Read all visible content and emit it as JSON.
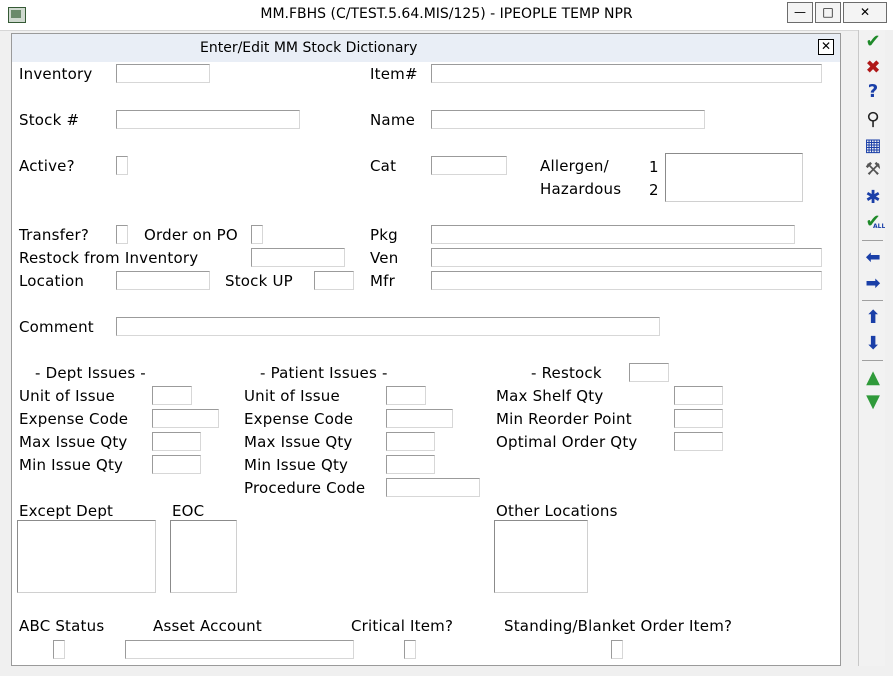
{
  "window": {
    "title": "MM.FBHS (C/TEST.5.64.MIS/125) - IPEOPLE TEMP NPR",
    "minimize_glyph": "—",
    "maximize_glyph": "□",
    "close_glyph": "✕"
  },
  "form": {
    "title": "Enter/Edit MM Stock Dictionary",
    "close_glyph": "✕",
    "labels": {
      "inventory": "Inventory",
      "item_no": "Item#",
      "stock_no": "Stock #",
      "name": "Name",
      "active": "Active?",
      "cat": "Cat",
      "allergen": "Allergen/",
      "hazardous": "Hazardous",
      "allergen_1": "1",
      "allergen_2": "2",
      "transfer": "Transfer?",
      "order_on_po": "Order on PO",
      "pkg": "Pkg",
      "restock_from_inventory": "Restock from Inventory",
      "ven": "Ven",
      "location": "Location",
      "stock_up": "Stock UP",
      "mfr": "Mfr",
      "comment": "Comment",
      "dept_issues": "- Dept Issues -",
      "patient_issues": "- Patient Issues -",
      "restock": "- Restock",
      "dept_unit_of_issue": "Unit of Issue",
      "dept_expense_code": "Expense Code",
      "dept_max_issue_qty": "Max Issue Qty",
      "dept_min_issue_qty": "Min Issue Qty",
      "pat_unit_of_issue": "Unit of Issue",
      "pat_expense_code": "Expense Code",
      "pat_max_issue_qty": "Max Issue Qty",
      "pat_min_issue_qty": "Min Issue Qty",
      "procedure_code": "Procedure Code",
      "max_shelf_qty": "Max Shelf Qty",
      "min_reorder_point": "Min Reorder Point",
      "optimal_order_qty": "Optimal Order Qty",
      "except_dept": "Except Dept",
      "eoc": "EOC",
      "other_locations": "Other Locations",
      "abc_status": "ABC Status",
      "asset_account": "Asset Account",
      "critical_item": "Critical Item?",
      "standing_blanket": "Standing/Blanket Order Item?"
    },
    "values": {
      "inventory": "",
      "item_no": "",
      "stock_no": "",
      "name": "",
      "cat": "",
      "pkg": "",
      "restock_from_inventory": "",
      "ven": "",
      "location": "",
      "stock_up": "",
      "mfr": "",
      "comment": "",
      "restock": "",
      "dept_unit_of_issue": "",
      "dept_expense_code": "",
      "dept_max_issue_qty": "",
      "dept_min_issue_qty": "",
      "pat_unit_of_issue": "",
      "pat_expense_code": "",
      "pat_max_issue_qty": "",
      "pat_min_issue_qty": "",
      "procedure_code": "",
      "max_shelf_qty": "",
      "min_reorder_point": "",
      "optimal_order_qty": "",
      "asset_account": ""
    }
  },
  "toolbar": {
    "items": [
      {
        "name": "ok-icon",
        "glyph": "✔",
        "color": "#1f8a2a"
      },
      {
        "name": "cancel-icon",
        "glyph": "✖",
        "color": "#b01818"
      },
      {
        "name": "help-icon",
        "glyph": "?",
        "color": "#1a3fa8"
      },
      {
        "name": "lookup-icon",
        "glyph": "⚲",
        "color": "#222222"
      },
      {
        "name": "table-edit-icon",
        "glyph": "▦",
        "color": "#1a3fa8"
      },
      {
        "name": "tools-icon",
        "glyph": "⚒",
        "color": "#555555"
      },
      {
        "name": "asterisk-icon",
        "glyph": "✱",
        "color": "#1a3fa8"
      },
      {
        "name": "ok-all-icon",
        "glyph": "✔",
        "color": "#1f8a2a",
        "sub": "ALL"
      },
      {
        "name": "arrow-left-icon",
        "glyph": "⬅",
        "color": "#1a3fa8"
      },
      {
        "name": "arrow-right-icon",
        "glyph": "➡",
        "color": "#1a3fa8"
      },
      {
        "name": "arrow-up-icon",
        "glyph": "⬆",
        "color": "#1a3fa8"
      },
      {
        "name": "arrow-down-icon",
        "glyph": "⬇",
        "color": "#1a3fa8"
      },
      {
        "name": "page-up-icon",
        "glyph": "▲",
        "color": "#2f9a3a"
      },
      {
        "name": "page-down-icon",
        "glyph": "▼",
        "color": "#2f9a3a"
      }
    ]
  }
}
